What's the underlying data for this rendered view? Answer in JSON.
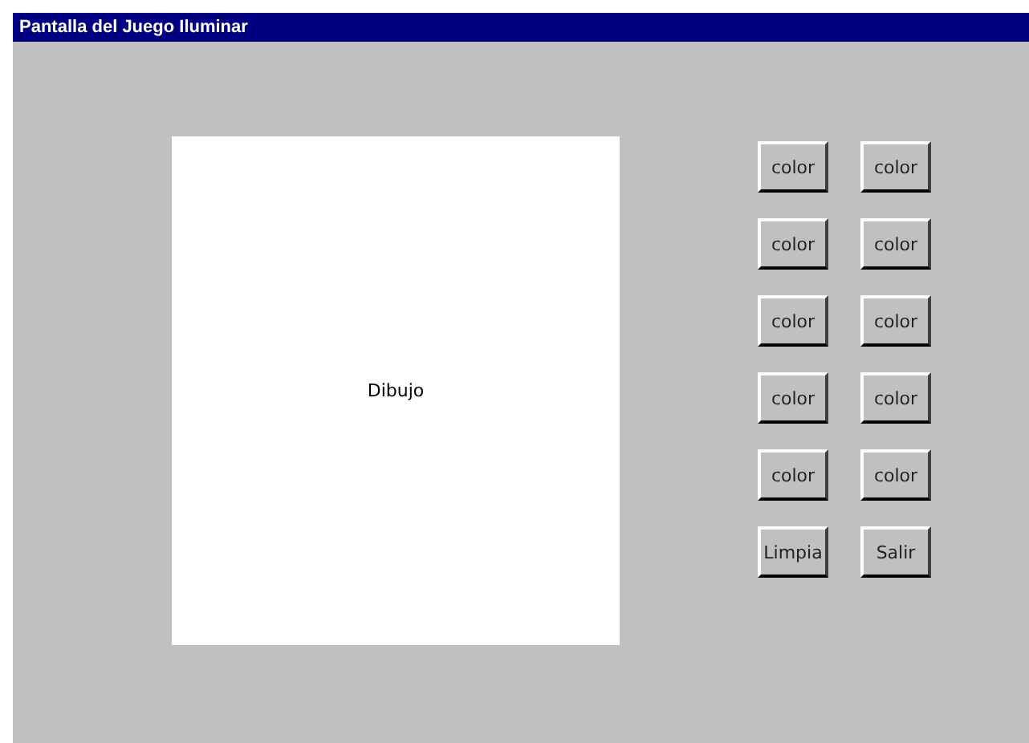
{
  "window": {
    "title": "Pantalla del Juego Iluminar"
  },
  "canvas": {
    "label": "Dibujo"
  },
  "buttons": [
    [
      "color",
      "color"
    ],
    [
      "color",
      "color"
    ],
    [
      "color",
      "color"
    ],
    [
      "color",
      "color"
    ],
    [
      "color",
      "color"
    ],
    [
      "Limpia",
      "Salir"
    ]
  ]
}
